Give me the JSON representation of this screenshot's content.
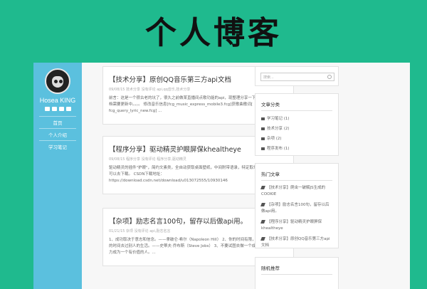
{
  "banner": {
    "title": "个人博客"
  },
  "sidebar": {
    "name": "Hosea KING",
    "nav": [
      "首页",
      "个人介绍",
      "学习笔记"
    ]
  },
  "posts": [
    {
      "title": "【技术分享】原创QQ音乐第三方api文档",
      "meta": "09/08/15  技术分享  没有评论  api,qq音乐,技术分享",
      "body": [
        "前言：这是一个很古老的坑了，很久之前做某直播间点歌功能的api，现整理分享一下。来完，文",
        "档需要更新中。。。。 修改音乐信息[fcg_music_express_mobile3.fcg]获歌曲歌词[",
        "fcg_query_lyric_new.fcg] ..."
      ]
    },
    {
      "title": "【程序分享】驱动精灵护眼屏保khealtheye",
      "meta": "09/08/15  程序分享  没有评论  程序分享,驱动精灵",
      "body": [
        "驱动精灵的插件\"护眼\"，简约文素类，全自动获取桌面壁纸，中间附带语录，特定取单用，需要的",
        "可以去下载。 CSDN下载地址：",
        "https://download.csdn.net/download/u013072555/10930146"
      ]
    },
    {
      "title": "【杂项】励志名言100句，留存以后做api用。",
      "meta": "01/21/15  杂项  没有评论  api,励志名言",
      "body": [
        "1、成功取决于意志和信念。——拿破仑·希尔（Napoleon Hill） 2、你的时间有限，所以别浪费",
        "的时间去过别人的生活。——史蒂夫·乔布斯（Steve Jobs） 3、不要试图去做一个成功的人，要努",
        "力成为一个有价值的人。..."
      ]
    }
  ],
  "search": {
    "placeholder": "搜索..."
  },
  "categories": {
    "title": "文章分类",
    "items": [
      "学习笔记 (1)",
      "技术分享 (2)",
      "杂项 (2)",
      "程序发布 (1)"
    ]
  },
  "hot": {
    "title": "热门文章",
    "items": [
      "【技术分享】爬虫一破解JS生成的COOKIE",
      "【杂项】励志名言100句，留存以后做api用。",
      "【程序分享】驱动精灵护眼屏保khealtheye",
      "【技术分享】原创QQ音乐第三方api文档"
    ]
  },
  "recommend": {
    "title": "随机推荐"
  }
}
